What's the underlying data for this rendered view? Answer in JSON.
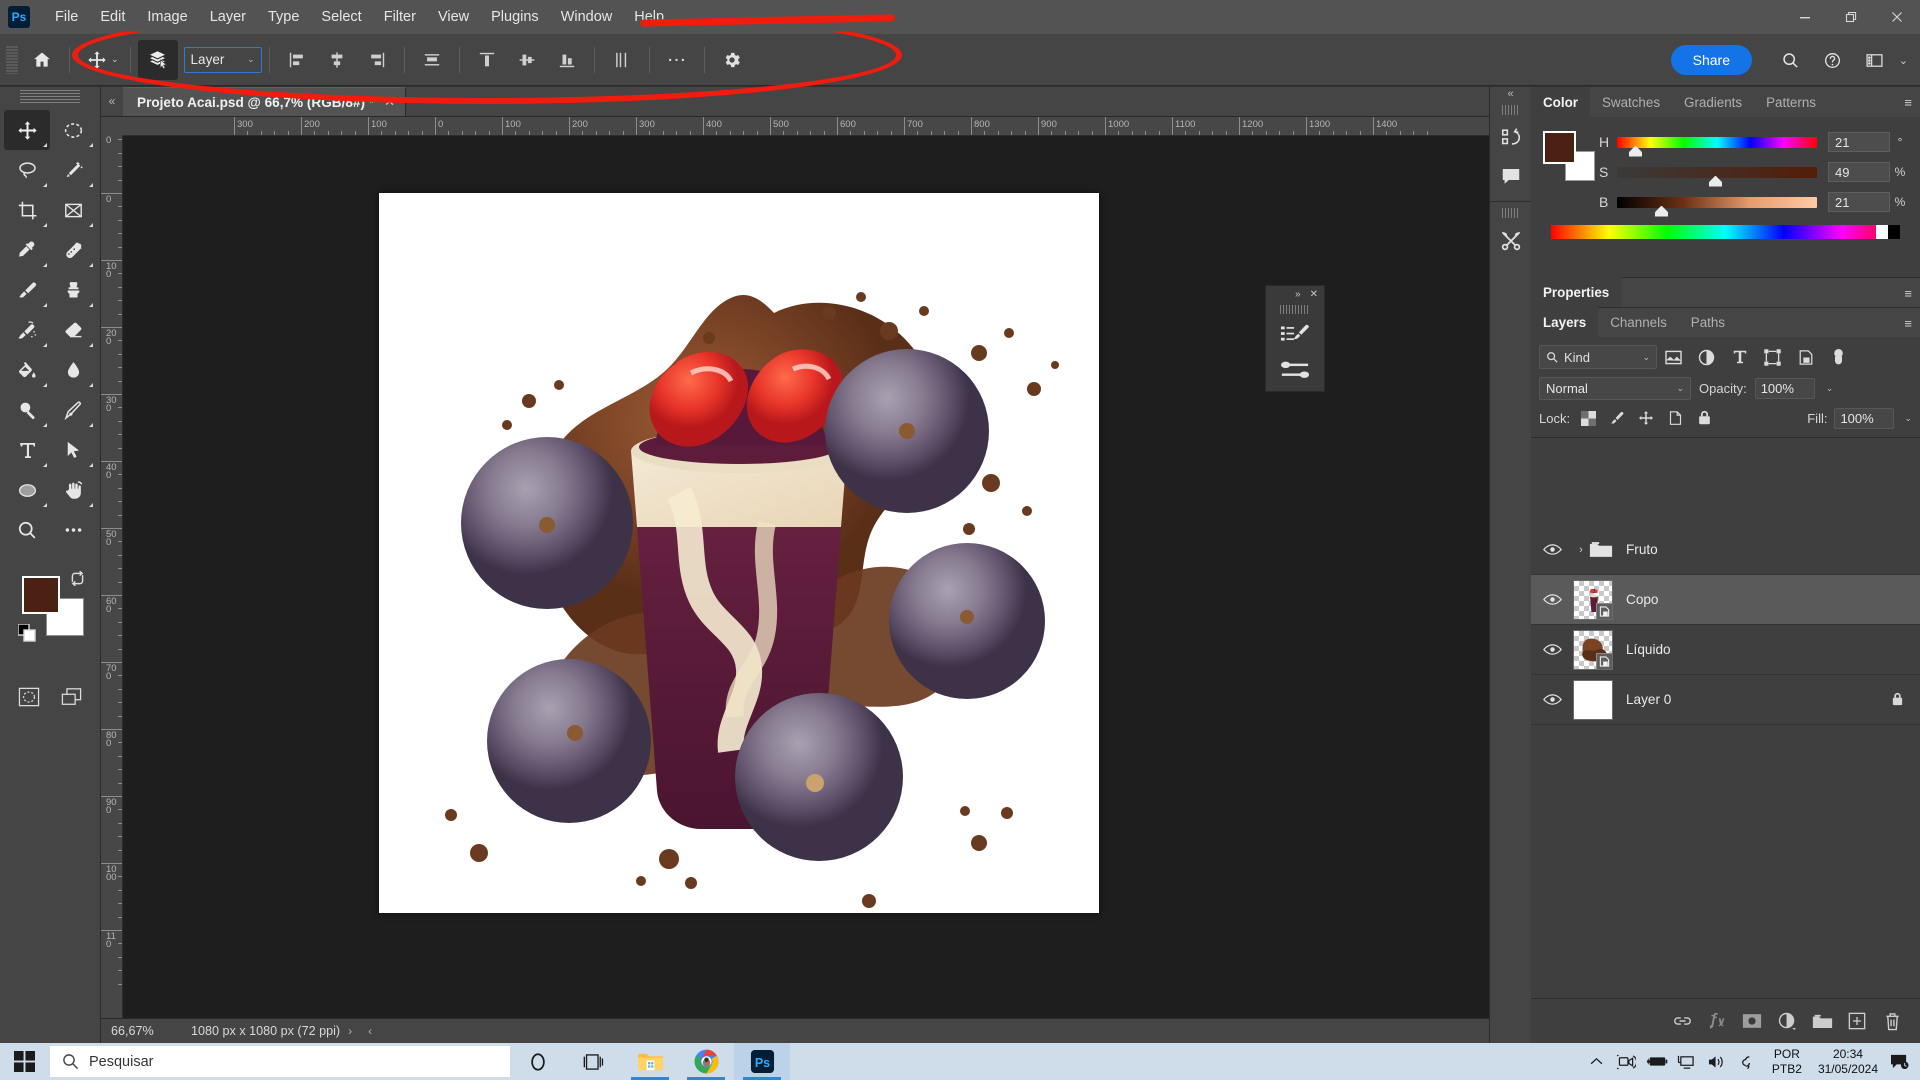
{
  "app": {
    "name": "Adobe Photoshop",
    "logo_text": "Ps"
  },
  "menubar": {
    "items": [
      "File",
      "Edit",
      "Image",
      "Layer",
      "Type",
      "Select",
      "Filter",
      "View",
      "Plugins",
      "Window",
      "Help"
    ]
  },
  "window_controls": {
    "minimize": "—",
    "maximize": "❐",
    "close": "✕"
  },
  "options_bar": {
    "tool_label": "Move Tool",
    "auto_select_label": "Layer",
    "share_label": "Share",
    "more_label": "…",
    "align_buttons": [
      "align-left-edges",
      "align-horizontal-centers",
      "align-right-edges",
      "distribute-horizontally",
      "align-top-edges",
      "align-vertical-centers",
      "align-bottom-edges",
      "distribute-vertically"
    ]
  },
  "toolbar": {
    "tools": [
      {
        "name": "move-tool",
        "glyph": "move",
        "active": true
      },
      {
        "name": "elliptical-marquee-tool",
        "glyph": "ellipse-marquee",
        "active": false
      },
      {
        "name": "lasso-tool",
        "glyph": "lasso",
        "active": false
      },
      {
        "name": "object-selection-tool",
        "glyph": "magic-wand",
        "active": false
      },
      {
        "name": "crop-tool",
        "glyph": "crop",
        "active": false
      },
      {
        "name": "frame-tool",
        "glyph": "frame",
        "active": false
      },
      {
        "name": "eyedropper-tool",
        "glyph": "eyedropper",
        "active": false
      },
      {
        "name": "healing-brush-tool",
        "glyph": "healing",
        "active": false
      },
      {
        "name": "brush-tool",
        "glyph": "brush",
        "active": false
      },
      {
        "name": "clone-stamp-tool",
        "glyph": "stamp",
        "active": false
      },
      {
        "name": "history-brush-tool",
        "glyph": "history-brush",
        "active": false
      },
      {
        "name": "eraser-tool",
        "glyph": "eraser",
        "active": false
      },
      {
        "name": "gradient-tool",
        "glyph": "paint-bucket",
        "active": false
      },
      {
        "name": "blur-tool",
        "glyph": "blur-drop",
        "active": false
      },
      {
        "name": "dodge-tool",
        "glyph": "dodge",
        "active": false
      },
      {
        "name": "pen-tool",
        "glyph": "pen",
        "active": false
      },
      {
        "name": "horizontal-type-tool",
        "glyph": "type",
        "active": false
      },
      {
        "name": "path-selection-tool",
        "glyph": "arrow",
        "active": false
      },
      {
        "name": "ellipse-tool",
        "glyph": "ellipse-shape",
        "active": false
      },
      {
        "name": "hand-tool",
        "glyph": "hand",
        "active": false
      },
      {
        "name": "zoom-tool",
        "glyph": "zoom",
        "active": false
      },
      {
        "name": "edit-toolbar-tool",
        "glyph": "ellipsis",
        "active": false
      }
    ],
    "foreground_color": "#4a2113",
    "background_color": "#ffffff"
  },
  "document": {
    "tab_title": "Projeto Acai.psd @ 66,7% (RGB/8#) *",
    "close_glyph": "✕"
  },
  "rulers": {
    "horizontal_labels": [
      "300",
      "200",
      "100",
      "0",
      "100",
      "200",
      "300",
      "400",
      "500",
      "600",
      "700",
      "800",
      "900",
      "1000",
      "1100",
      "1200",
      "1300",
      "1400"
    ],
    "vertical_labels": [
      "200",
      "0",
      "100",
      "200",
      "300",
      "400",
      "500",
      "600",
      "700",
      "800",
      "900",
      "1000",
      "110"
    ]
  },
  "mini_panel": {
    "collapse_glyph": "»",
    "close_glyph": "✕",
    "buttons": [
      "brush-settings-icon",
      "brush-presets-icon"
    ]
  },
  "statusbar": {
    "zoom": "66,67%",
    "dimensions": "1080 px x 1080 px (72 ppi)",
    "next_glyph": "›",
    "prev_glyph": "‹"
  },
  "rail": {
    "collapse_glyph": "«",
    "buttons": [
      "history-icon",
      "comments-icon",
      "discover-icon"
    ]
  },
  "color_panel": {
    "tabs": [
      {
        "label": "Color",
        "active": true
      },
      {
        "label": "Swatches",
        "active": false
      },
      {
        "label": "Gradients",
        "active": false
      },
      {
        "label": "Patterns",
        "active": false
      }
    ],
    "menu_glyph": "≡",
    "foreground_color": "#4a2113",
    "background_color": "#ffffff",
    "sliders": [
      {
        "label": "H",
        "value": "21",
        "unit": "°",
        "pos_pct": 8
      },
      {
        "label": "S",
        "value": "49",
        "unit": "%",
        "pos_pct": 48
      },
      {
        "label": "B",
        "value": "21",
        "unit": "%",
        "pos_pct": 21
      }
    ]
  },
  "properties_panel": {
    "tab_label": "Properties",
    "menu_glyph": "≡"
  },
  "layers_panel": {
    "tabs": [
      {
        "label": "Layers",
        "active": true
      },
      {
        "label": "Channels",
        "active": false
      },
      {
        "label": "Paths",
        "active": false
      }
    ],
    "menu_glyph": "≡",
    "filter": {
      "label": "Kind",
      "search_icon": "search-icon",
      "caret": "⌄"
    },
    "filter_icons": [
      "pixel-layer-filter-icon",
      "adjustment-layer-filter-icon",
      "type-layer-filter-icon",
      "shape-layer-filter-icon",
      "smart-object-filter-icon",
      "filter-toggle-icon"
    ],
    "blend_mode": "Normal",
    "opacity_label": "Opacity:",
    "opacity_value": "100%",
    "fill_label": "Fill:",
    "fill_value": "100%",
    "lock_label": "Lock:",
    "lock_icons": [
      "lock-transparent-pixels-icon",
      "lock-image-pixels-icon",
      "lock-position-icon",
      "lock-artboard-nesting-icon",
      "lock-all-icon"
    ],
    "layers": [
      {
        "name": "Fruto",
        "type": "group",
        "visible": true,
        "selected": false,
        "locked": false,
        "expand_glyph": "›"
      },
      {
        "name": "Copo",
        "type": "smart-object",
        "visible": true,
        "selected": true,
        "locked": false
      },
      {
        "name": "Líquido",
        "type": "smart-object",
        "visible": true,
        "selected": false,
        "locked": false
      },
      {
        "name": "Layer 0",
        "type": "pixel",
        "visible": true,
        "selected": false,
        "locked": true
      }
    ],
    "footer_buttons": [
      "link-layers-icon",
      "add-layer-style-icon",
      "add-layer-mask-icon",
      "new-adjustment-layer-icon",
      "new-group-icon",
      "new-layer-icon",
      "delete-layer-icon"
    ]
  },
  "taskbar": {
    "start_label": "Start",
    "search_placeholder": "Pesquisar",
    "apps": [
      {
        "name": "cortana-icon",
        "running": false,
        "active": false
      },
      {
        "name": "task-view-icon",
        "running": false,
        "active": false
      },
      {
        "name": "file-explorer-icon",
        "running": true,
        "active": false
      },
      {
        "name": "google-chrome-icon",
        "running": true,
        "active": false
      },
      {
        "name": "photoshop-icon",
        "running": true,
        "active": true
      }
    ],
    "tray_icons": [
      "show-hidden-icons-chevron",
      "camera-icon",
      "battery-icon",
      "network-icon",
      "volume-icon",
      "onedrive-icon"
    ],
    "language_line1": "POR",
    "language_line2": "PTB2",
    "time": "20:34",
    "date": "31/05/2024",
    "action_center_icon": "action-center-icon"
  },
  "annotation": {
    "shape": "red-ellipse-highlight",
    "color": "#f01c0d"
  }
}
